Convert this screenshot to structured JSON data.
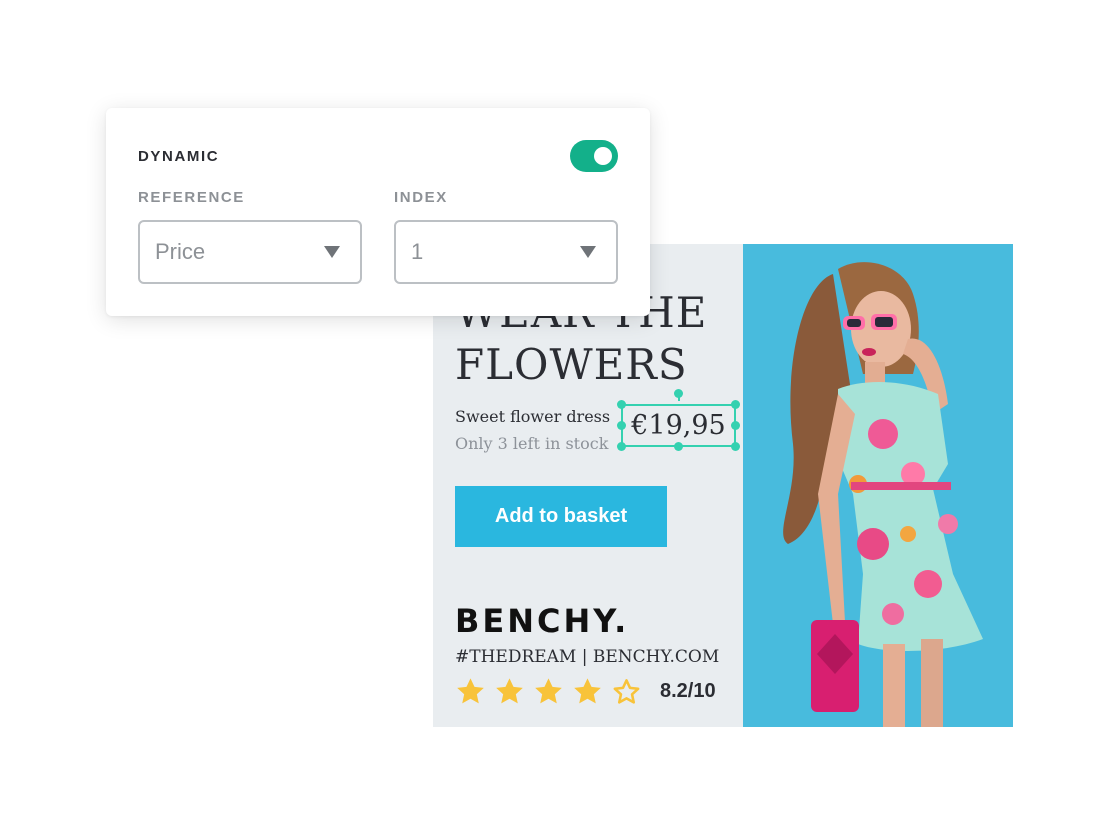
{
  "panel": {
    "title": "DYNAMIC",
    "toggle_on": true,
    "reference": {
      "label": "REFERENCE",
      "value": "Price"
    },
    "index": {
      "label": "INDEX",
      "value": "1"
    }
  },
  "ad": {
    "headline_line1": "WEAR THE",
    "headline_line2": "FLOWERS",
    "product_name": "Sweet flower dress",
    "stock_text": "Only 3 left in stock",
    "price": "€19,95",
    "button_label": "Add to basket",
    "brand": "BENCHY.",
    "tagline": "#THEDREAM | BENCHY.COM",
    "rating": {
      "stars": 4,
      "max_stars": 5,
      "score_text": "8.2/10"
    }
  },
  "colors": {
    "toggle": "#13b08a",
    "button": "#2ab7df",
    "selection": "#34d1b0",
    "star": "#f8c33a",
    "photo_bg": "#48bbdd"
  }
}
